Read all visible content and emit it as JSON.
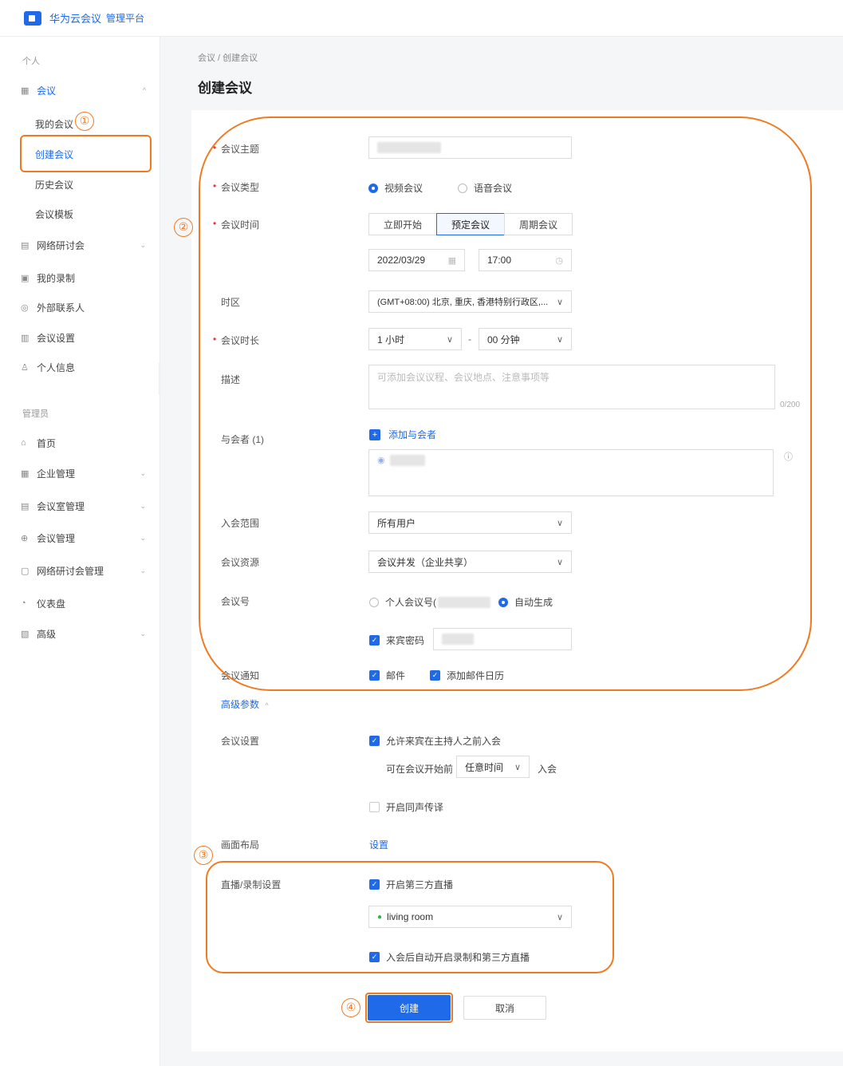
{
  "header": {
    "brand": "华为云会议",
    "subtitle": "管理平台"
  },
  "sidebar": {
    "section_personal": "个人",
    "meeting_group": "会议",
    "meeting_subitems": [
      "我的会议",
      "创建会议",
      "历史会议",
      "会议模板"
    ],
    "personal_items": [
      "网络研讨会",
      "我的录制",
      "外部联系人",
      "会议设置",
      "个人信息"
    ],
    "section_admin": "管理员",
    "admin_items": [
      "首页",
      "企业管理",
      "会议室管理",
      "会议管理",
      "网络研讨会管理",
      "仪表盘",
      "高级"
    ]
  },
  "breadcrumb": "会议 / 创建会议",
  "page_title": "创建会议",
  "form": {
    "subject_label": "会议主题",
    "type_label": "会议类型",
    "type_video": "视频会议",
    "type_audio": "语音会议",
    "time_label": "会议时间",
    "time_options": [
      "立即开始",
      "预定会议",
      "周期会议"
    ],
    "date_value": "2022/03/29",
    "time_value": "17:00",
    "timezone_label": "时区",
    "timezone_value": "(GMT+08:00) 北京, 重庆, 香港特别行政区,...",
    "duration_label": "会议时长",
    "duration_hours": "1 小时",
    "duration_sep": "-",
    "duration_minutes": "00 分钟",
    "desc_label": "描述",
    "desc_placeholder": "可添加会议议程、会议地点、注意事项等",
    "desc_counter": "0/200",
    "attendees_label": "与会者 (1)",
    "add_attendee": "添加与会者",
    "scope_label": "入会范围",
    "scope_value": "所有用户",
    "resource_label": "会议资源",
    "resource_value": "会议并发（企业共享）",
    "meeting_id_label": "会议号",
    "meeting_id_personal": "个人会议号(",
    "meeting_id_auto": "自动生成",
    "guest_password": "来宾密码",
    "notify_label": "会议通知",
    "notify_email": "邮件",
    "notify_calendar": "添加邮件日历",
    "advanced": "高级参数",
    "settings_label": "会议设置",
    "allow_before_host": "允许来宾在主持人之前入会",
    "join_before_prefix": "可在会议开始前",
    "join_before_value": "任意时间",
    "join_before_suffix": "入会",
    "interpretation": "开启同声传译",
    "layout_label": "画面布局",
    "layout_link": "设置",
    "live_label": "直播/录制设置",
    "live_third_party": "开启第三方直播",
    "live_room": "living room",
    "auto_record": "入会后自动开启录制和第三方直播"
  },
  "buttons": {
    "create": "创建",
    "cancel": "取消"
  },
  "annotations": [
    "①",
    "②",
    "③",
    "④"
  ],
  "colors": {
    "primary": "#1f6ae8",
    "annotation": "#f07a22",
    "required": "#e33333"
  }
}
